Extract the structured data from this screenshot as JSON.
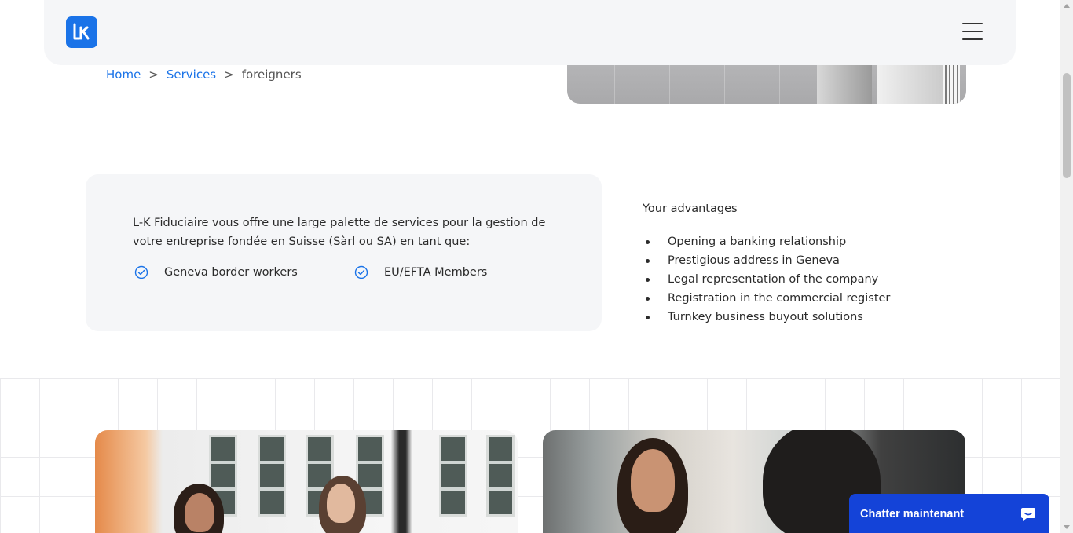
{
  "header": {
    "logo_alt": "L-K logo",
    "menu_icon": "hamburger-menu-icon"
  },
  "breadcrumb": {
    "home": "Home",
    "separator": ">",
    "services": "Services",
    "current": "foreigners"
  },
  "info": {
    "text": "L-K Fiduciaire vous offre une large palette de services pour la gestion de votre entreprise fondée en Suisse (Sàrl ou SA) en tant que:",
    "checks": [
      {
        "label": "Geneva border workers",
        "icon": "check-circle-icon"
      },
      {
        "label": "EU/EFTA Members",
        "icon": "check-circle-icon"
      }
    ]
  },
  "advantages": {
    "title": "Your advantages",
    "items": [
      "Opening a banking relationship",
      "Prestigious address in Geneva",
      "Legal representation of the company",
      "Registration in the commercial register",
      "Turnkey business buyout solutions"
    ]
  },
  "chat": {
    "label": "Chatter maintenant",
    "icon": "chat-bubble-icon"
  },
  "colors": {
    "accent": "#1a73e8",
    "chat_bg": "#1443d8",
    "card_bg": "#f5f6f8"
  }
}
